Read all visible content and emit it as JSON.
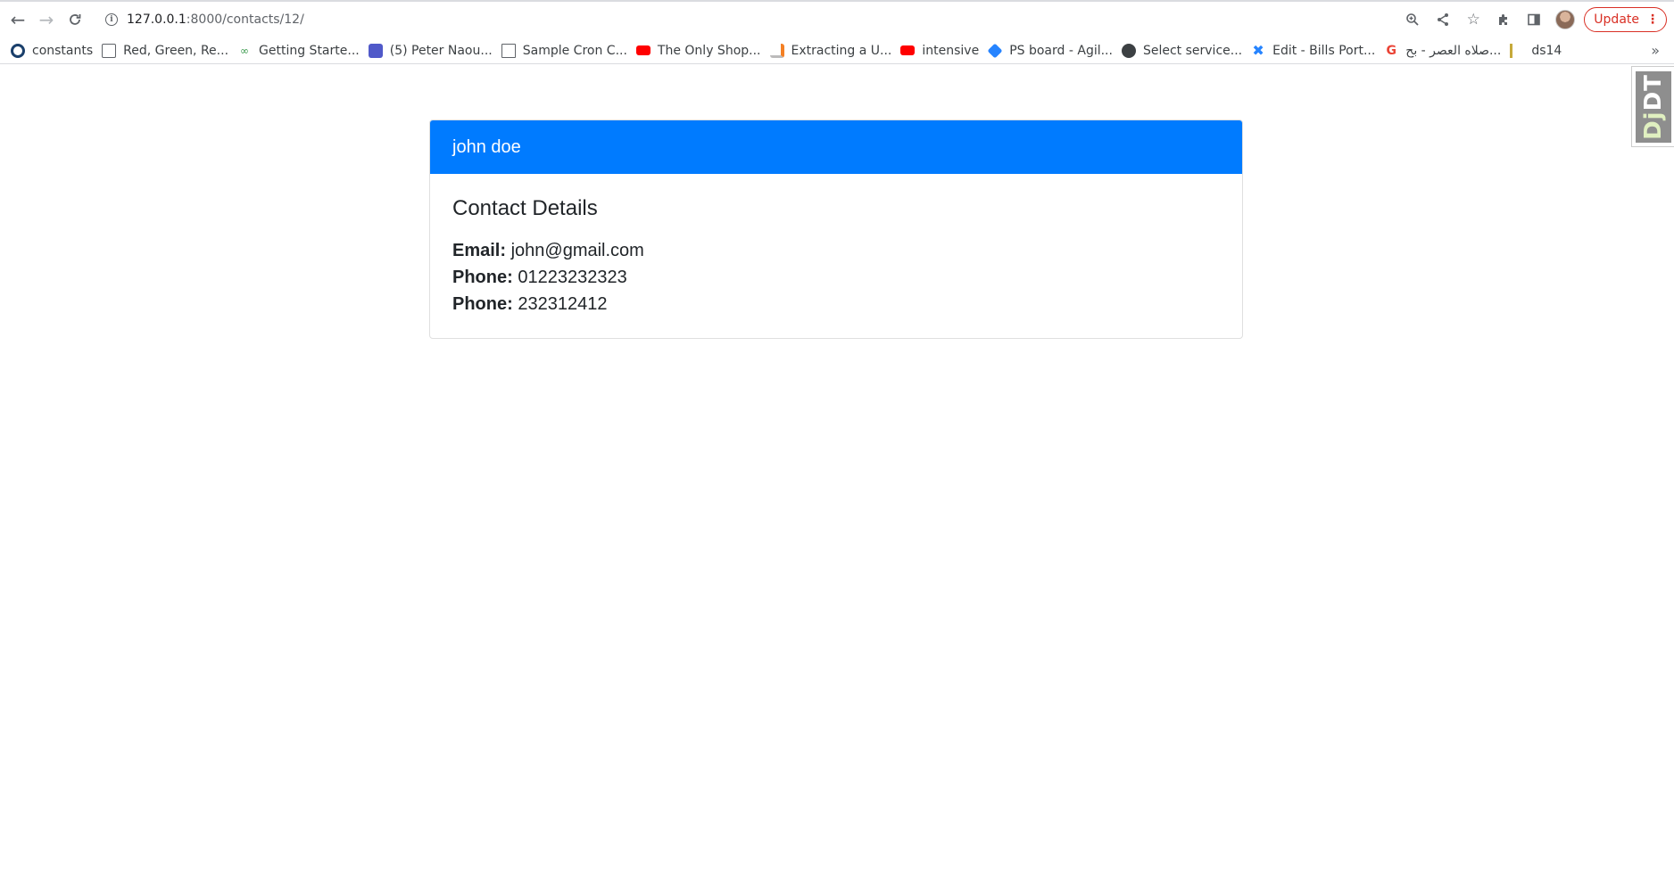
{
  "browser": {
    "url_host": "127.0.0.1",
    "url_rest": ":8000/contacts/12/",
    "update_label": "Update",
    "bookmarks": [
      {
        "label": "constants",
        "icon": "globe-icon",
        "color": "#1a3f6b"
      },
      {
        "label": "Red, Green, Re...",
        "icon": "doc-icon",
        "color": "#5f6368"
      },
      {
        "label": "Getting Starte...",
        "icon": "link-icon",
        "color": "#3c9a4e"
      },
      {
        "label": "(5) Peter Naou...",
        "icon": "teams-icon",
        "color": "#5059c9"
      },
      {
        "label": "Sample Cron C...",
        "icon": "building-icon",
        "color": "#5f6368"
      },
      {
        "label": "The Only Shop...",
        "icon": "youtube-icon",
        "color": "#ff0000"
      },
      {
        "label": "Extracting a U...",
        "icon": "stackoverflow-icon",
        "color": "#f48024"
      },
      {
        "label": "intensive",
        "icon": "youtube-icon",
        "color": "#ff0000"
      },
      {
        "label": "PS board - Agil...",
        "icon": "jira-icon",
        "color": "#2684ff"
      },
      {
        "label": "Select service...",
        "icon": "globe-icon",
        "color": "#3c4043"
      },
      {
        "label": "Edit - Bills Port...",
        "icon": "confluence-icon",
        "color": "#2684ff"
      },
      {
        "label": "صلاه العصر - بح...",
        "icon": "google-icon",
        "color": "#ea4335"
      },
      {
        "label": "ds14",
        "icon": "django-icon",
        "color": "#c6a93b"
      }
    ],
    "more_label": "»"
  },
  "djdt": {
    "label_dj": "Dj",
    "label_dt": "DT"
  },
  "contact": {
    "name": "john doe",
    "section_title": "Contact Details",
    "email_label": "Email:",
    "email": "john@gmail.com",
    "phone_label": "Phone:",
    "phones": [
      "01223232323",
      "232312412"
    ]
  },
  "colors": {
    "accent": "#007bff"
  }
}
